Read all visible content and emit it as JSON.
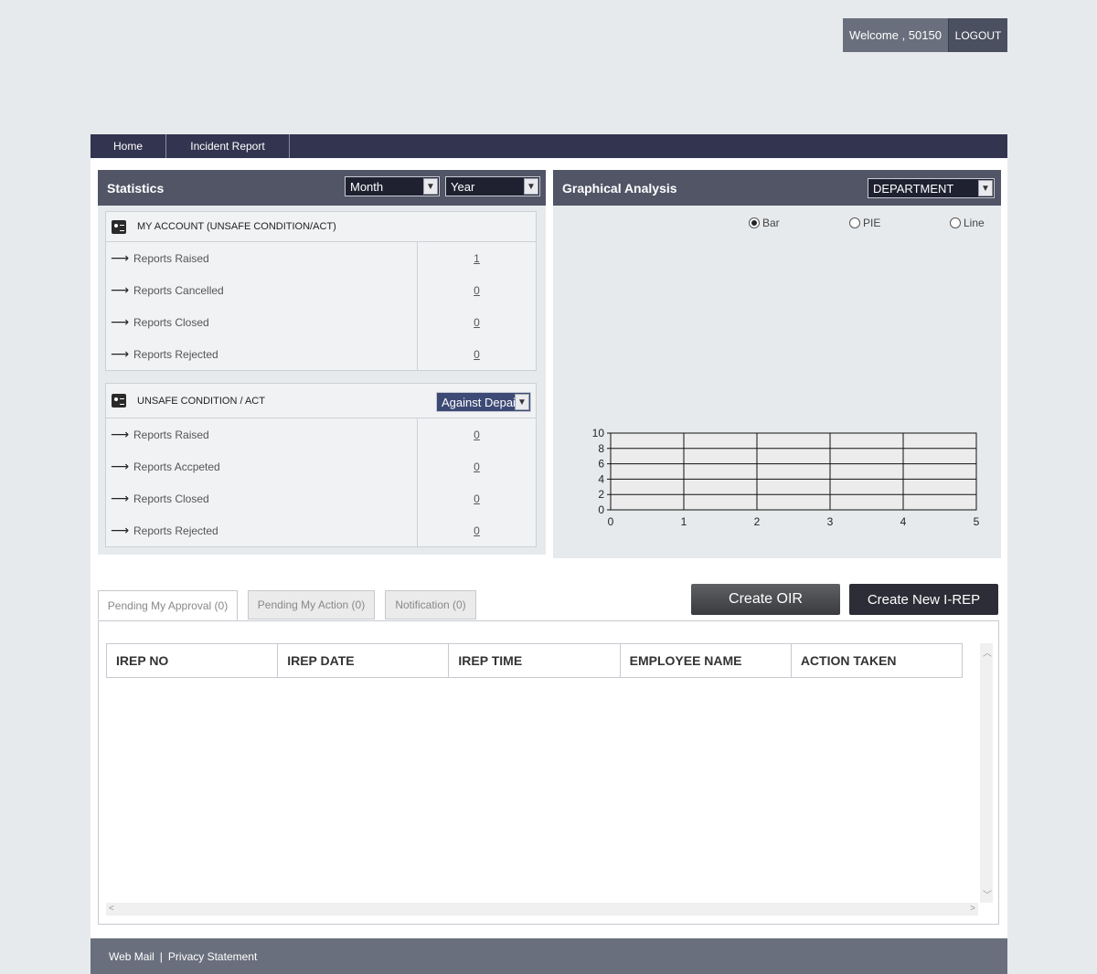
{
  "user": {
    "welcome": "Welcome , 50150",
    "logout": "LOGOUT"
  },
  "nav": {
    "home": "Home",
    "incident_report": "Incident Report"
  },
  "statistics": {
    "title": "Statistics",
    "month_select": "Month",
    "year_select": "Year",
    "my_account": {
      "title": "MY ACCOUNT (UNSAFE CONDITION/ACT)",
      "rows": [
        {
          "label": "Reports Raised",
          "value": "1"
        },
        {
          "label": "Reports Cancelled",
          "value": "0"
        },
        {
          "label": "Reports Closed",
          "value": "0"
        },
        {
          "label": "Reports Rejected",
          "value": "0"
        }
      ]
    },
    "unsafe": {
      "title": "UNSAFE CONDITION / ACT",
      "filter_select": "Against Depai",
      "rows": [
        {
          "label": "Reports Raised",
          "value": "0"
        },
        {
          "label": "Reports Accpeted",
          "value": "0"
        },
        {
          "label": "Reports Closed",
          "value": "0"
        },
        {
          "label": "Reports Rejected",
          "value": "0"
        }
      ]
    },
    "arrow": "⟶"
  },
  "graph": {
    "title": "Graphical Analysis",
    "dimension_select": "DEPARTMENT",
    "options": [
      {
        "label": "Bar",
        "selected": true
      },
      {
        "label": "PIE",
        "selected": false
      },
      {
        "label": "Line",
        "selected": false
      }
    ]
  },
  "chart_data": {
    "type": "bar",
    "x": [],
    "values": [],
    "xlim": [
      0,
      5
    ],
    "ylim": [
      0,
      10
    ],
    "xticks": [
      "0",
      "1",
      "2",
      "3",
      "4",
      "5"
    ],
    "yticks": [
      "0",
      "2",
      "4",
      "6",
      "8",
      "10"
    ],
    "grid": true
  },
  "tabs": [
    {
      "label": "Pending My Approval (0)",
      "active": true
    },
    {
      "label": "Pending My Action (0)",
      "active": false
    },
    {
      "label": "Notification (0)",
      "active": false
    }
  ],
  "buttons": {
    "create_oir": "Create OIR",
    "create_irep": "Create New I-REP"
  },
  "table": {
    "columns": [
      "IREP NO",
      "IREP DATE",
      "IREP TIME",
      "EMPLOYEE NAME",
      "ACTION TAKEN"
    ]
  },
  "footer": {
    "webmail": "Web Mail",
    "separator": "|",
    "privacy": "Privacy Statement"
  }
}
